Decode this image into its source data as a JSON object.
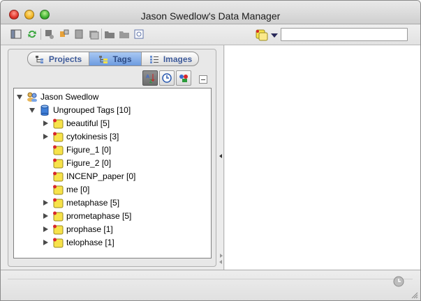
{
  "window": {
    "title": "Jason Swedlow's Data Manager"
  },
  "toolbar": {
    "icons": [
      "browser-view-icon",
      "refresh-icon",
      "annotate-icon",
      "classify-icon",
      "clipboard-icon",
      "image-list-icon",
      "tag-folder-icon",
      "folder-icon",
      "preview-icon"
    ],
    "search": {
      "value": "",
      "placeholder": ""
    },
    "filter_icon": "tag-filter-icon"
  },
  "tabs": [
    {
      "label": "Projects",
      "icon": "hierarchy-icon",
      "selected": false
    },
    {
      "label": "Tags",
      "icon": "tag-tree-icon",
      "selected": true
    },
    {
      "label": "Images",
      "icon": "image-list-icon",
      "selected": false
    }
  ],
  "tree_tools": [
    "sort-alpha-icon",
    "clock-icon",
    "add-tag-icon"
  ],
  "tree": {
    "root": {
      "label": "Jason Swedlow",
      "icon": "users-icon"
    },
    "group": {
      "label": "Ungrouped Tags [10]",
      "icon": "database-icon"
    },
    "items": [
      {
        "label": "beautiful [5]",
        "expandable": true
      },
      {
        "label": "cytokinesis [3]",
        "expandable": true
      },
      {
        "label": "Figure_1 [0]",
        "expandable": false
      },
      {
        "label": "Figure_2 [0]",
        "expandable": false
      },
      {
        "label": "INCENP_paper [0]",
        "expandable": false
      },
      {
        "label": "me [0]",
        "expandable": false
      },
      {
        "label": "metaphase [5]",
        "expandable": true
      },
      {
        "label": "prometaphase [5]",
        "expandable": true
      },
      {
        "label": "prophase [1]",
        "expandable": true
      },
      {
        "label": "telophase [1]",
        "expandable": true
      }
    ]
  },
  "colors": {
    "tag_yellow": "#f7e24a",
    "tag_red_dot": "#d8262a",
    "tab_selected": "#8fb6ec",
    "tab_text": "#3d5a9a"
  }
}
